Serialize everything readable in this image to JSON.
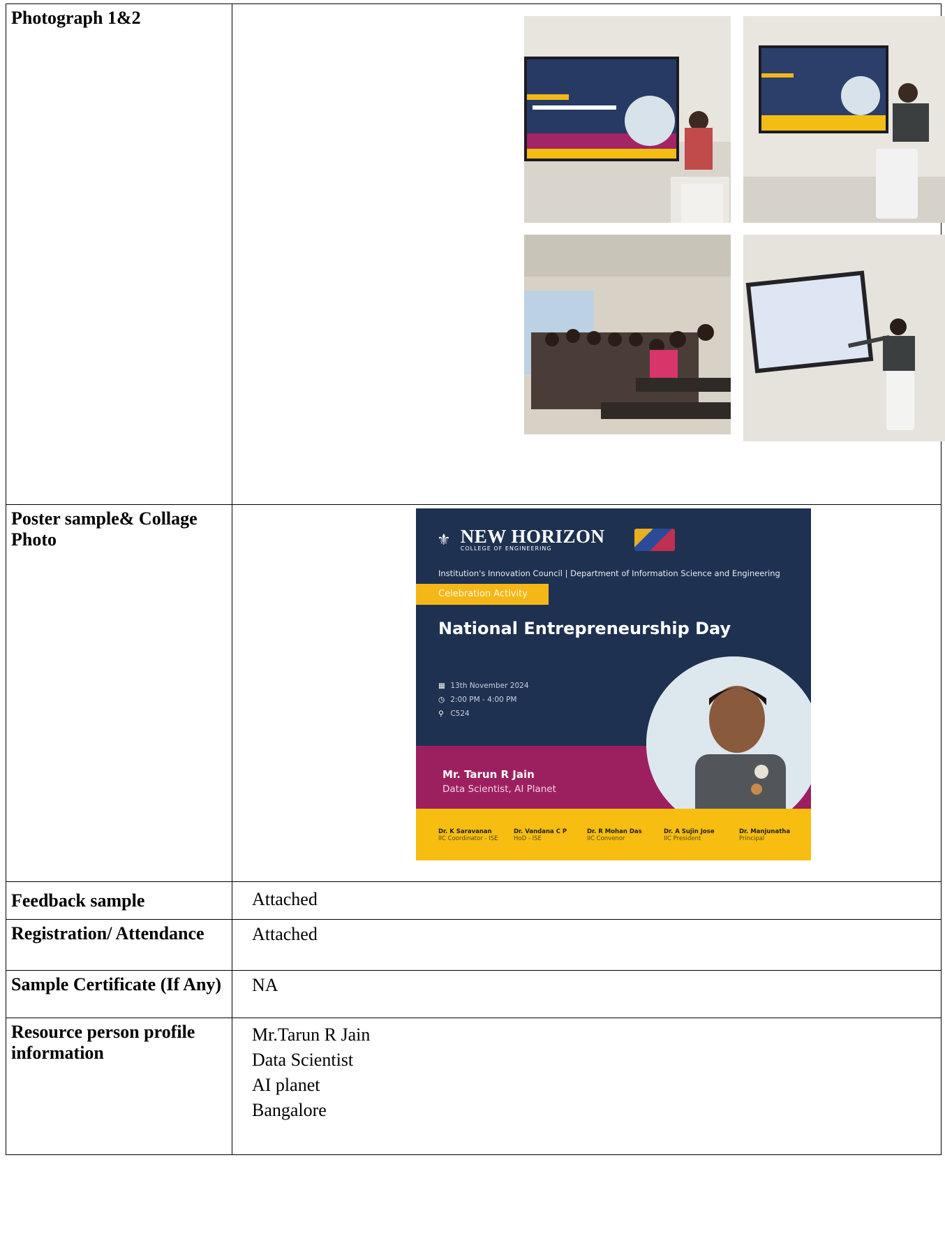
{
  "rows": {
    "photos": {
      "label": "Photograph 1&2"
    },
    "poster": {
      "label": "Poster sample& Collage Photo",
      "college_name": "NEW HORIZON",
      "college_sub": "COLLEGE OF ENGINEERING",
      "council_line": "Institution's Innovation Council | Department of Information Science and Engineering",
      "badge": "Celebration Activity",
      "headline": "National Entrepreneurship Day",
      "date": "13th November 2024",
      "time": "2:00 PM - 4:00 PM",
      "venue": "C524",
      "speaker_name": "Mr. Tarun R Jain",
      "speaker_role": "Data Scientist, AI Planet",
      "signatories": [
        {
          "name": "Dr. K Saravanan",
          "role": "IIC Coordinator - ISE"
        },
        {
          "name": "Dr. Vandana C P",
          "role": "HoD - ISE"
        },
        {
          "name": "Dr. R Mohan Das",
          "role": "IIC Convenor"
        },
        {
          "name": "Dr. A Sujin Jose",
          "role": "IIC President"
        },
        {
          "name": "Dr. Manjunatha",
          "role": "Principal"
        }
      ]
    },
    "feedback": {
      "label": "Feedback sample",
      "value": "Attached"
    },
    "registration": {
      "label": "Registration/ Attendance",
      "value": "Attached"
    },
    "certificate": {
      "label": "Sample Certificate (If Any)",
      "value": "NA"
    },
    "resource": {
      "label": "Resource person profile information",
      "lines": [
        "Mr.Tarun R Jain",
        "Data Scientist",
        "AI planet",
        "Bangalore"
      ]
    }
  },
  "colors": {
    "poster_navy": "#1f3150",
    "poster_yellow": "#f7bd10",
    "poster_magenta": "#9c2060"
  },
  "icons": {
    "date": "calendar-icon",
    "time": "clock-icon",
    "venue": "location-pin-icon"
  }
}
